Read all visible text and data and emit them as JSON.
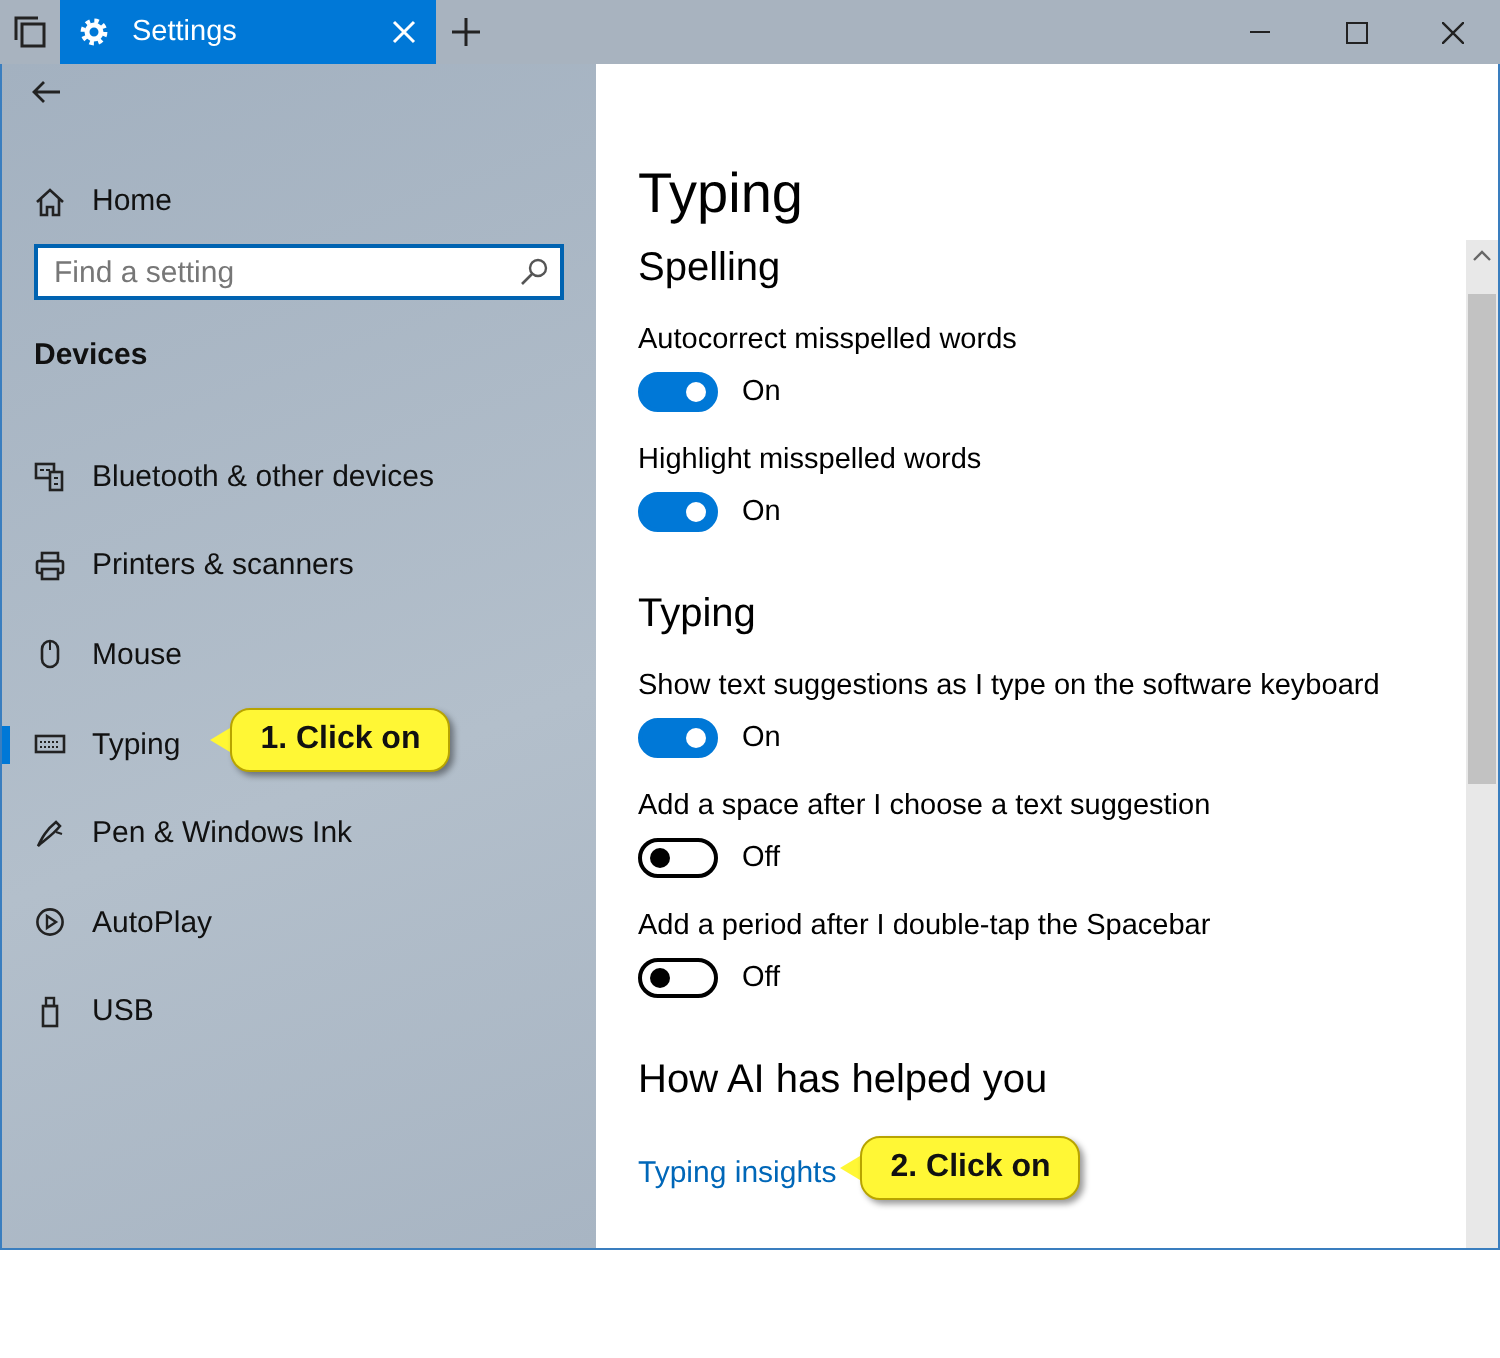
{
  "window": {
    "tab_title": "Settings"
  },
  "sidebar": {
    "home": "Home",
    "search": {
      "placeholder": "Find a setting"
    },
    "section": "Devices",
    "items": [
      {
        "label": "Bluetooth & other devices",
        "selected": false
      },
      {
        "label": "Printers & scanners",
        "selected": false
      },
      {
        "label": "Mouse",
        "selected": false
      },
      {
        "label": "Typing",
        "selected": true,
        "callout": "1. Click on"
      },
      {
        "label": "Pen & Windows Ink",
        "selected": false
      },
      {
        "label": "AutoPlay",
        "selected": false
      },
      {
        "label": "USB",
        "selected": false
      }
    ]
  },
  "content": {
    "title": "Typing",
    "sections": [
      {
        "heading": "Spelling",
        "settings": [
          {
            "label": "Autocorrect misspelled words",
            "on": true,
            "state": "On"
          },
          {
            "label": "Highlight misspelled words",
            "on": true,
            "state": "On"
          }
        ]
      },
      {
        "heading": "Typing",
        "settings": [
          {
            "label": "Show text suggestions as I type on the software keyboard",
            "on": true,
            "state": "On"
          },
          {
            "label": "Add a space after I choose a text suggestion",
            "on": false,
            "state": "Off"
          },
          {
            "label": "Add a period after I double-tap the Spacebar",
            "on": false,
            "state": "Off"
          }
        ]
      },
      {
        "heading": "How AI has helped you",
        "link": "Typing insights",
        "callout": "2. Click on"
      }
    ]
  }
}
